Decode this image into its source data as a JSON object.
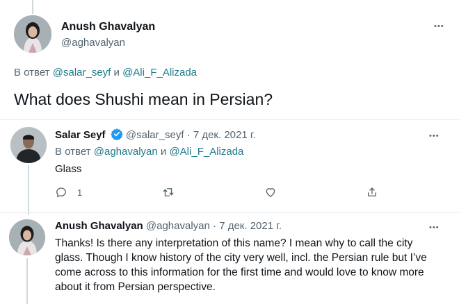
{
  "main_tweet": {
    "author_name": "Anush Ghavalyan",
    "author_handle": "@aghavalyan",
    "reply_prefix": "В ответ",
    "reply_user1": "@salar_seyf",
    "reply_and": "и",
    "reply_user2": "@Ali_F_Alizada",
    "text": "What does Shushi mean in Persian?"
  },
  "reply1": {
    "author_name": "Salar Seyf",
    "author_handle": "@salar_seyf",
    "separator": "·",
    "date": "7 дек. 2021 г.",
    "reply_prefix": "В ответ",
    "reply_user1": "@aghavalyan",
    "reply_and": "и",
    "reply_user2": "@Ali_F_Alizada",
    "text": "Glass",
    "reply_count": "1"
  },
  "reply2": {
    "author_name": "Anush Ghavalyan",
    "author_handle": "@aghavalyan",
    "separator": "·",
    "date": "7 дек. 2021 г.",
    "text": "Thanks! Is there any interpretation of this name? I mean why to call the city glass. Though I know history of the city very well, incl. the Persian rule but I’ve come across to this information for the first time and would love to know more about it from Persian perspective."
  },
  "more_glyph": "•••",
  "colors": {
    "text": "#0f1419",
    "muted": "#536471",
    "link": "#1d7a8a",
    "verified": "#1d9bf0",
    "divider": "#e6ecf0"
  },
  "icons": [
    "more-icon",
    "verified-icon",
    "reply-icon",
    "retweet-icon",
    "like-icon",
    "share-icon"
  ]
}
